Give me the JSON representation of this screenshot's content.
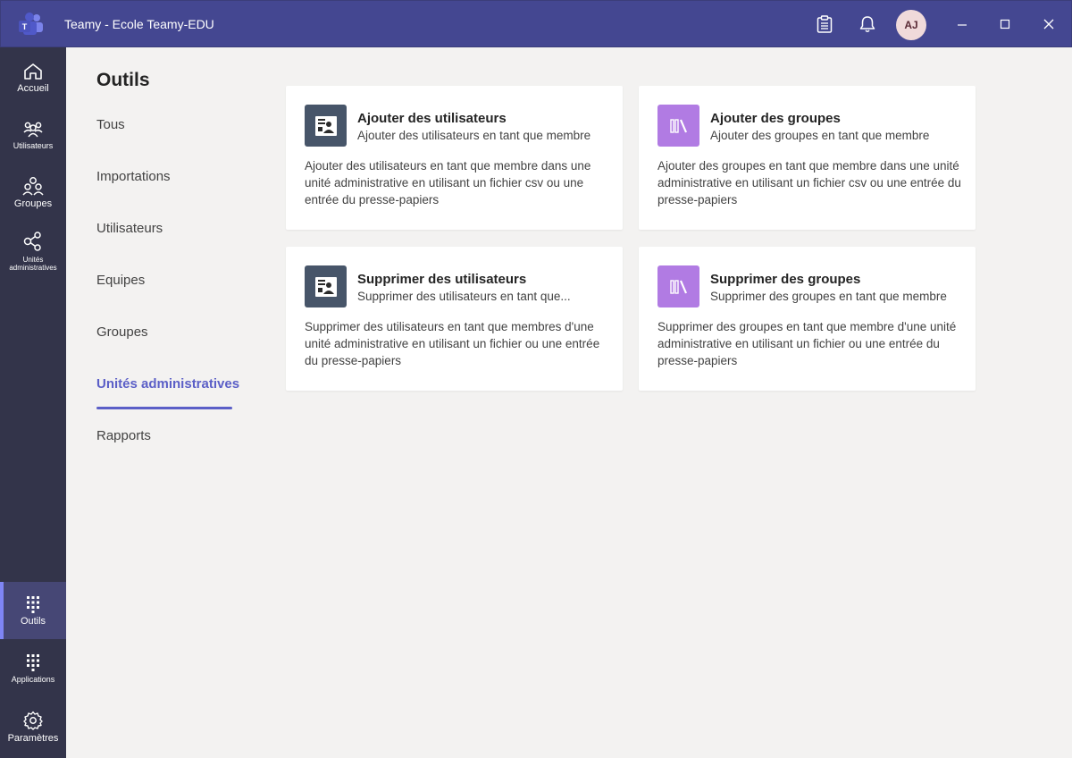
{
  "window": {
    "title": "Teamy - Ecole Teamy-EDU",
    "avatar_initials": "AJ"
  },
  "colors": {
    "titlebar": "#444791",
    "rail": "#33344a",
    "accent": "#5b5fc7",
    "card_icon_dark": "#475569",
    "card_icon_purple": "#b17be3"
  },
  "rail": {
    "accueil": "Accueil",
    "utilisateurs": "Utilisateurs",
    "groupes": "Groupes",
    "unites": "Unités administratives",
    "outils": "Outils",
    "applications": "Applications",
    "parametres": "Paramètres"
  },
  "main": {
    "title": "Outils",
    "subnav": [
      "Tous",
      "Importations",
      "Utilisateurs",
      "Equipes",
      "Groupes",
      "Unités administratives",
      "Rapports"
    ],
    "active_subnav": "Unités administratives",
    "cards": [
      {
        "title": "Ajouter des utilisateurs",
        "subtitle": "Ajouter des utilisateurs en tant que membre",
        "description": "Ajouter des utilisateurs en tant que membre dans une unité administrative en utilisant un fichier csv ou une entrée du presse-papiers"
      },
      {
        "title": "Ajouter des groupes",
        "subtitle": "Ajouter des groupes en tant que membre",
        "description": "Ajouter des groupes en tant que membre dans une unité administrative en utilisant un fichier csv ou une entrée du presse-papiers"
      },
      {
        "title": "Supprimer des utilisateurs",
        "subtitle": "Supprimer des utilisateurs en tant que...",
        "description": "Supprimer des utilisateurs en tant que membres d'une unité administrative en utilisant un fichier ou une entrée du presse-papiers"
      },
      {
        "title": "Supprimer des groupes",
        "subtitle": "Supprimer des groupes en tant que membre",
        "description": "Supprimer des groupes en tant que membre d'une unité administrative en utilisant un fichier ou une entrée du presse-papiers"
      }
    ]
  }
}
